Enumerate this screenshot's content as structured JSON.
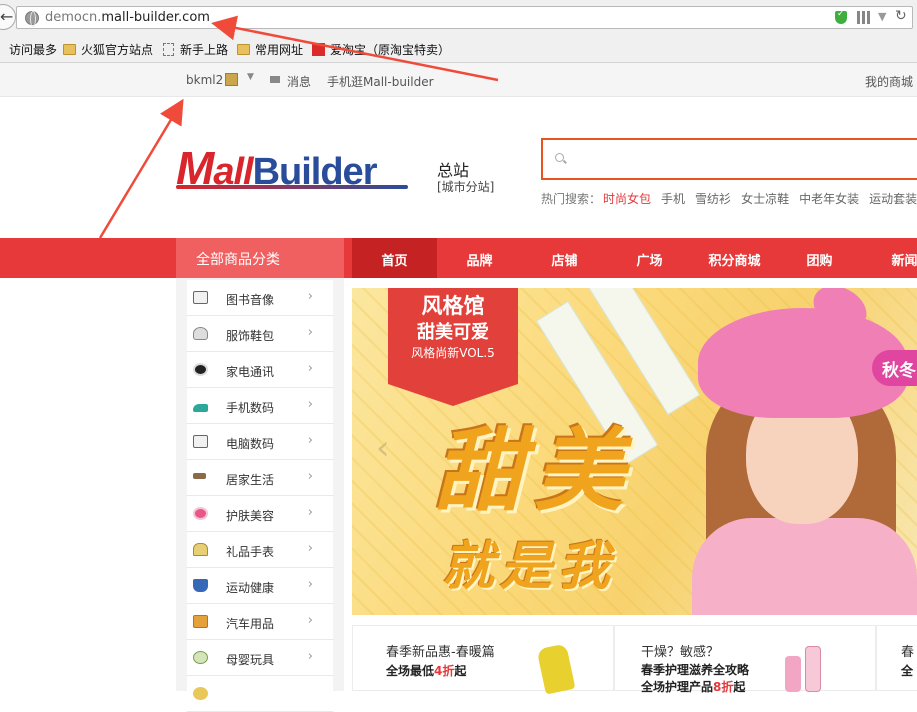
{
  "browser": {
    "url_prefix": "democn.",
    "url_domain": "mall-builder.com",
    "bookmarks": [
      "访问最多",
      "火狐官方站点",
      "新手上路",
      "常用网址",
      "爱淘宝（原淘宝特卖）"
    ]
  },
  "topbar": {
    "username": "bkml2",
    "messages": "消息",
    "mobile": "手机逛Mall-builder",
    "my_mall": "我的商城"
  },
  "header": {
    "logo_text": "MallBuilder",
    "site_name": "总站",
    "city_link": "[城市分站]",
    "search": {
      "placeholder": "",
      "value": ""
    },
    "hot_label": "热门搜索：",
    "hot_terms": [
      "时尚女包",
      "手机",
      "雪纺衫",
      "女士凉鞋",
      "中老年女装",
      "运动套装"
    ]
  },
  "nav": {
    "all_categories": "全部商品分类",
    "items": [
      "首页",
      "品牌",
      "店铺",
      "广场",
      "积分商城",
      "团购",
      "新闻"
    ]
  },
  "categories": [
    {
      "label": "图书音像",
      "icon": "camera-icon"
    },
    {
      "label": "服饰鞋包",
      "icon": "bag-icon"
    },
    {
      "label": "家电通讯",
      "icon": "soccer-ball-icon"
    },
    {
      "label": "手机数码",
      "icon": "high-heel-icon"
    },
    {
      "label": "电脑数码",
      "icon": "camera-icon"
    },
    {
      "label": "居家生活",
      "icon": "hairdryer-icon"
    },
    {
      "label": "护肤美容",
      "icon": "cosmetic-icon"
    },
    {
      "label": "礼品手表",
      "icon": "gift-icon"
    },
    {
      "label": "运动健康",
      "icon": "curtain-icon"
    },
    {
      "label": "汽车用品",
      "icon": "car-seat-icon"
    },
    {
      "label": "母婴玩具",
      "icon": "baby-icon"
    },
    {
      "label": "",
      "icon": "food-icon"
    }
  ],
  "banner": {
    "ribbon_title": "风格馆",
    "ribbon_subtitle": "甜美可爱",
    "ribbon_vol": "风格尚新VOL.5",
    "headline": "甜美",
    "headline_partial": "可",
    "subheadline": "就是我",
    "side_tag": "秋冬"
  },
  "promos": [
    {
      "title": "春季新品惠-春暖篇",
      "line1_prefix": "全场最低",
      "line1_highlight": "4折",
      "line1_suffix": "起",
      "line2_prefix": "",
      "line2_highlight": "",
      "line2_suffix": ""
    },
    {
      "title": "干燥？敏感？",
      "line1_prefix": "春季护理滋养全攻略",
      "line1_highlight": "",
      "line1_suffix": "",
      "line2_prefix": "全场护理产品",
      "line2_highlight": "8折",
      "line2_suffix": "起"
    },
    {
      "title": "春",
      "line1_prefix": "全",
      "line1_highlight": "",
      "line1_suffix": "",
      "line2_prefix": "",
      "line2_highlight": "",
      "line2_suffix": ""
    }
  ],
  "colors": {
    "nav_red": "#e8393a",
    "search_orange": "#e8541f",
    "highlight_red": "#e4393c",
    "logo_blue": "#2a4d9b"
  }
}
